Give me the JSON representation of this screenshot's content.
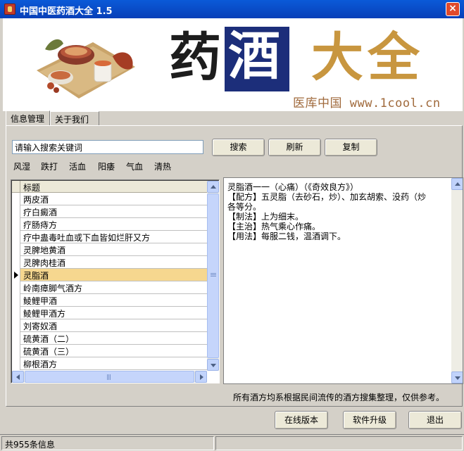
{
  "window": {
    "title": "中国中医药酒大全 1.5",
    "close_label": "×"
  },
  "banner": {
    "char1": "药",
    "char2": "酒",
    "char3": "大",
    "char4": "全",
    "subtitle": "医库中国 www.1cool.cn"
  },
  "tabs": [
    {
      "label": "信息管理",
      "active": true
    },
    {
      "label": "关于我们",
      "active": false
    }
  ],
  "search": {
    "value": "请输入搜索关键词",
    "search_label": "搜索",
    "refresh_label": "刷新",
    "copy_label": "复制"
  },
  "categories": [
    "风湿",
    "跌打",
    "活血",
    "阳痿",
    "气血",
    "清热"
  ],
  "list": {
    "header": "标题",
    "rows": [
      "两皮酒",
      "疗白癜酒",
      "疗肠痔方",
      "疗中蛊毒吐血或下血皆如烂肝又方",
      "灵脾地黄酒",
      "灵脾肉桂酒",
      "灵脂酒",
      "岭南瘴脚气酒方",
      "鲮鲤甲酒",
      "鲮鲤甲酒方",
      "刘寄奴酒",
      "硫黄酒（二）",
      "硫黄酒（三）",
      "柳根酒方"
    ],
    "selected_index": 6
  },
  "detail": {
    "lines": [
      "灵脂酒一一（心痛）（《奇效良方》）",
      "【配方】五灵脂（去砂石，炒）、加玄胡索、没药（炒",
      "各等分。",
      "【制法】上为细末。",
      "【主治】热气乘心作痛。",
      "【用法】每服二钱，温酒调下。"
    ]
  },
  "note": "所有酒方均系根据民间流传的酒方搜集整理，仅供参考。",
  "footer": {
    "online_label": "在线版本",
    "upgrade_label": "软件升级",
    "exit_label": "退出"
  },
  "status": {
    "count_text": "共955条信息"
  }
}
